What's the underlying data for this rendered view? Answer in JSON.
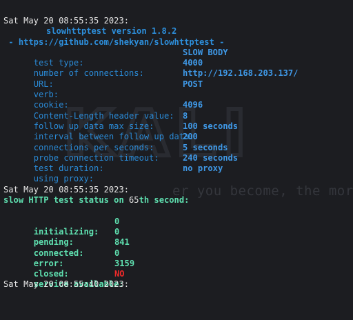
{
  "watermark": {
    "motto": "er you become, the more y"
  },
  "header": {
    "timestamp": "Sat May 20 08:55:35 2023:",
    "title": "slowhttptest version 1.8.2",
    "url_line": " - https://github.com/shekyan/slowhttptest -"
  },
  "params": [
    {
      "label": "test type:",
      "value": "SLOW BODY"
    },
    {
      "label": "number of connections:",
      "value": "4000"
    },
    {
      "label": "URL:",
      "value": "http://192.168.203.137/"
    },
    {
      "label": "verb:",
      "value": "POST"
    },
    {
      "label": "cookie:",
      "value": ""
    },
    {
      "label": "Content-Length header value:",
      "value": "4096"
    },
    {
      "label": "follow up data max size:",
      "value": "8"
    },
    {
      "label": "interval between follow up data:",
      "value": "100 seconds"
    },
    {
      "label": "connections per seconds:",
      "value": "200"
    },
    {
      "label": "probe connection timeout:",
      "value": "5 seconds"
    },
    {
      "label": "test duration:",
      "value": "240 seconds"
    },
    {
      "label": "using proxy:",
      "value": "no proxy"
    }
  ],
  "status": {
    "timestamp": "Sat May 20 08:55:35 2023:",
    "line_prefix": "slow HTTP test status on ",
    "second": "65",
    "line_suffix": "th second:",
    "stats": [
      {
        "label": "initializing:",
        "value": "0"
      },
      {
        "label": "pending:",
        "value": "0"
      },
      {
        "label": "connected:",
        "value": "841"
      },
      {
        "label": "error:",
        "value": "0"
      },
      {
        "label": "closed:",
        "value": "3159"
      }
    ],
    "service_label": "service available:",
    "service_value": "NO",
    "service_value_color": "#f02a2a"
  },
  "footer": {
    "timestamp": "Sat May 20 08:55:40 2023:"
  }
}
